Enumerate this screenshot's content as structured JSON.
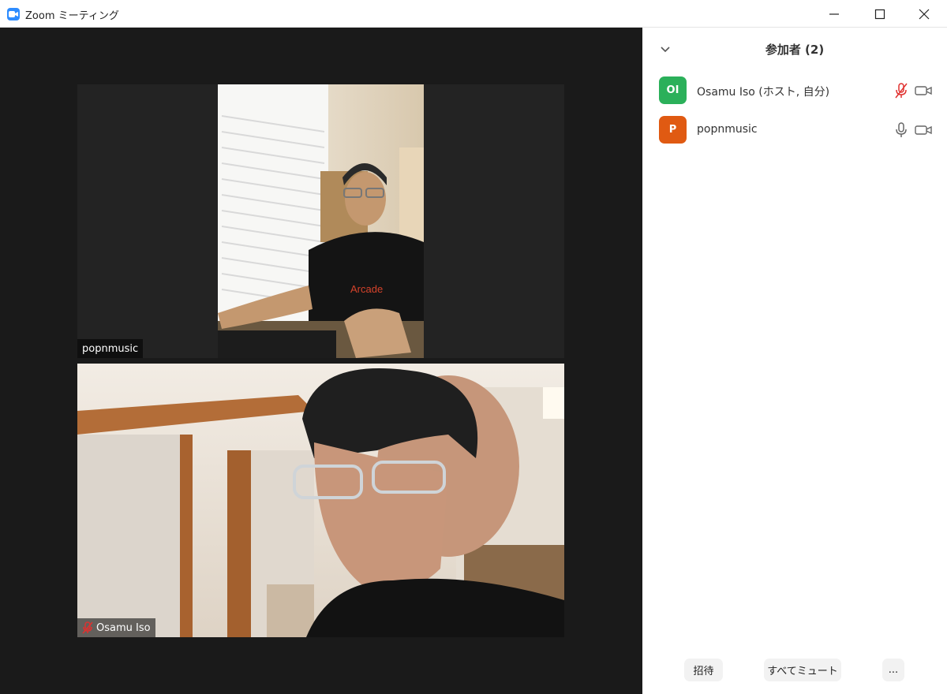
{
  "window": {
    "title": "Zoom ミーティング",
    "app_icon": "zoom-camera-icon",
    "controls": [
      "minimize-icon",
      "maximize-icon",
      "close-icon"
    ]
  },
  "gallery": {
    "tiles": [
      {
        "name": "popnmusic",
        "muted": false
      },
      {
        "name": "Osamu Iso",
        "muted": true
      }
    ]
  },
  "participants_panel": {
    "title": "参加者 (2)",
    "collapse_icon": "chevron-down-icon",
    "participants": [
      {
        "initials": "OI",
        "name": "Osamu Iso (ホスト, 自分)",
        "avatar_color": "#2bb05a",
        "mic": "muted",
        "video": "on"
      },
      {
        "initials": "P",
        "name": "popnmusic",
        "avatar_color": "#e05a12",
        "mic": "on",
        "video": "on"
      }
    ],
    "buttons": {
      "invite": "招待",
      "mute_all": "すべてミュート",
      "more": "..."
    }
  },
  "colors": {
    "zoom_blue": "#2d8cff",
    "muted_red": "#e0312f",
    "video_bg": "#1a1a1a"
  }
}
